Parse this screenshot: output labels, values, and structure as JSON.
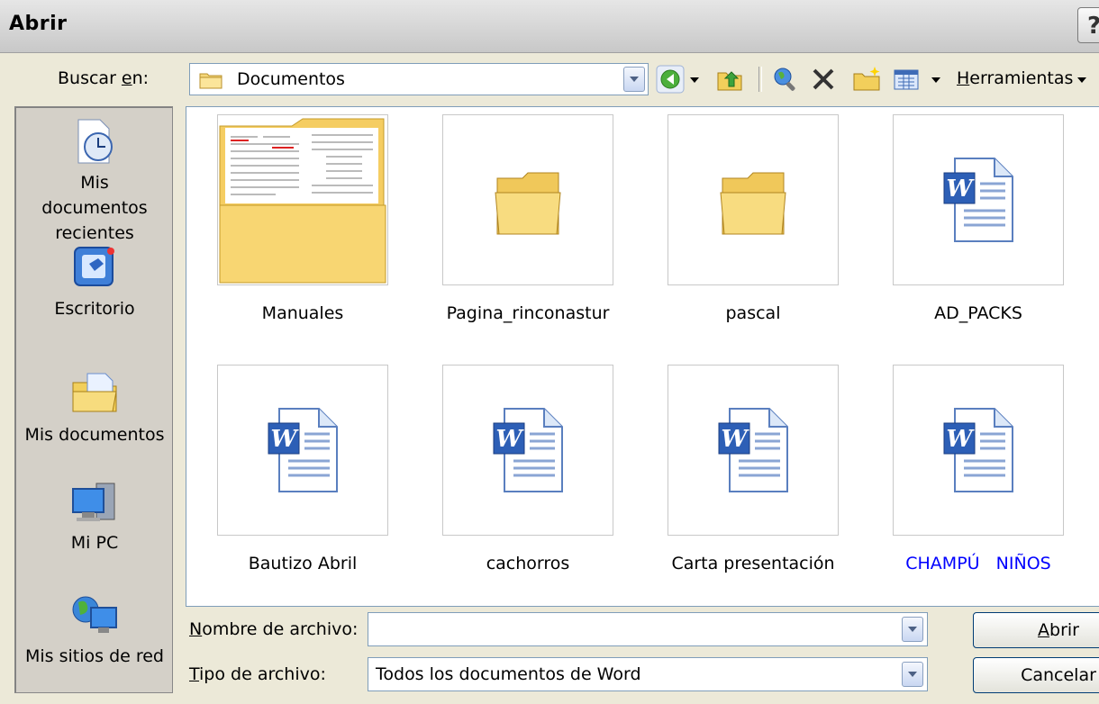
{
  "window": {
    "title": "Abrir",
    "help": "?"
  },
  "lookin": {
    "label_prefix": "Buscar ",
    "label_accel": "e",
    "label_suffix": "n:",
    "value": "Documentos"
  },
  "toolbar": {
    "tools_accel": "H",
    "tools_rest": "erramientas"
  },
  "places": [
    {
      "id": "recent",
      "label": "Mis documentos recientes"
    },
    {
      "id": "desktop",
      "label": "Escritorio"
    },
    {
      "id": "mydocs",
      "label": "Mis documentos"
    },
    {
      "id": "mypc",
      "label": "Mi PC"
    },
    {
      "id": "network",
      "label": "Mis sitios de red"
    }
  ],
  "files": [
    {
      "name": "Manuales",
      "kind": "folder-preview"
    },
    {
      "name": "Pagina_rinconastur",
      "kind": "folder"
    },
    {
      "name": "pascal",
      "kind": "folder"
    },
    {
      "name": "AD_PACKS",
      "kind": "word"
    },
    {
      "name": "Bautizo Abril",
      "kind": "word"
    },
    {
      "name": "cachorros",
      "kind": "word"
    },
    {
      "name": "Carta presentación",
      "kind": "word"
    },
    {
      "name": "CHAMPÚ   NIÑOS",
      "kind": "word",
      "color": "#0000ff"
    }
  ],
  "filename": {
    "label_accel": "N",
    "label_rest": "ombre de archivo:",
    "value": ""
  },
  "filetype": {
    "label_accel": "T",
    "label_rest": "ipo de archivo:",
    "value": "Todos los documentos de Word"
  },
  "buttons": {
    "open_accel": "A",
    "open_rest": "brir",
    "cancel": "Cancelar"
  },
  "colors": {
    "dialog_bg": "#ece9d8",
    "field_border": "#7f9db9",
    "blue_text": "#0000ff"
  }
}
